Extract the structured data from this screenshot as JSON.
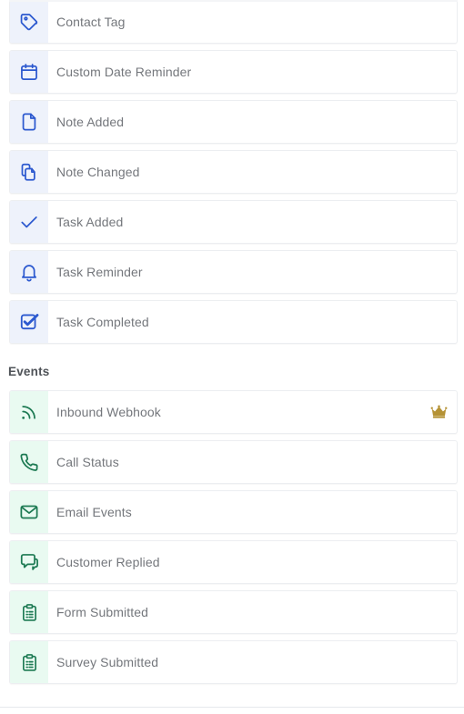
{
  "sections": [
    {
      "heading": null,
      "theme": "blue",
      "items": [
        {
          "label": "Contact Tag",
          "icon": "tag-icon",
          "badge": null
        },
        {
          "label": "Custom Date Reminder",
          "icon": "calendar-icon",
          "badge": null
        },
        {
          "label": "Note Added",
          "icon": "document-icon",
          "badge": null
        },
        {
          "label": "Note Changed",
          "icon": "copy-document-icon",
          "badge": null
        },
        {
          "label": "Task Added",
          "icon": "check-icon",
          "badge": null
        },
        {
          "label": "Task Reminder",
          "icon": "bell-icon",
          "badge": null
        },
        {
          "label": "Task Completed",
          "icon": "checkbox-checked-icon",
          "badge": null
        }
      ]
    },
    {
      "heading": "Events",
      "theme": "green",
      "items": [
        {
          "label": "Inbound Webhook",
          "icon": "rss-webhook-icon",
          "badge": "crown-icon"
        },
        {
          "label": "Call Status",
          "icon": "phone-icon",
          "badge": null
        },
        {
          "label": "Email Events",
          "icon": "envelope-icon",
          "badge": null
        },
        {
          "label": "Customer Replied",
          "icon": "chat-bubbles-icon",
          "badge": null
        },
        {
          "label": "Form Submitted",
          "icon": "clipboard-icon",
          "badge": null
        },
        {
          "label": "Survey Submitted",
          "icon": "clipboard-icon",
          "badge": null
        }
      ]
    }
  ],
  "colors": {
    "blue_icon": "#2c59cf",
    "blue_tint": "#eef2fb",
    "green_icon": "#1d7a53",
    "green_tint": "#e9faf1",
    "crown_gold": "#b59235",
    "label_text": "#74777c",
    "heading_text": "#4f5358",
    "row_border": "#eceef1"
  }
}
